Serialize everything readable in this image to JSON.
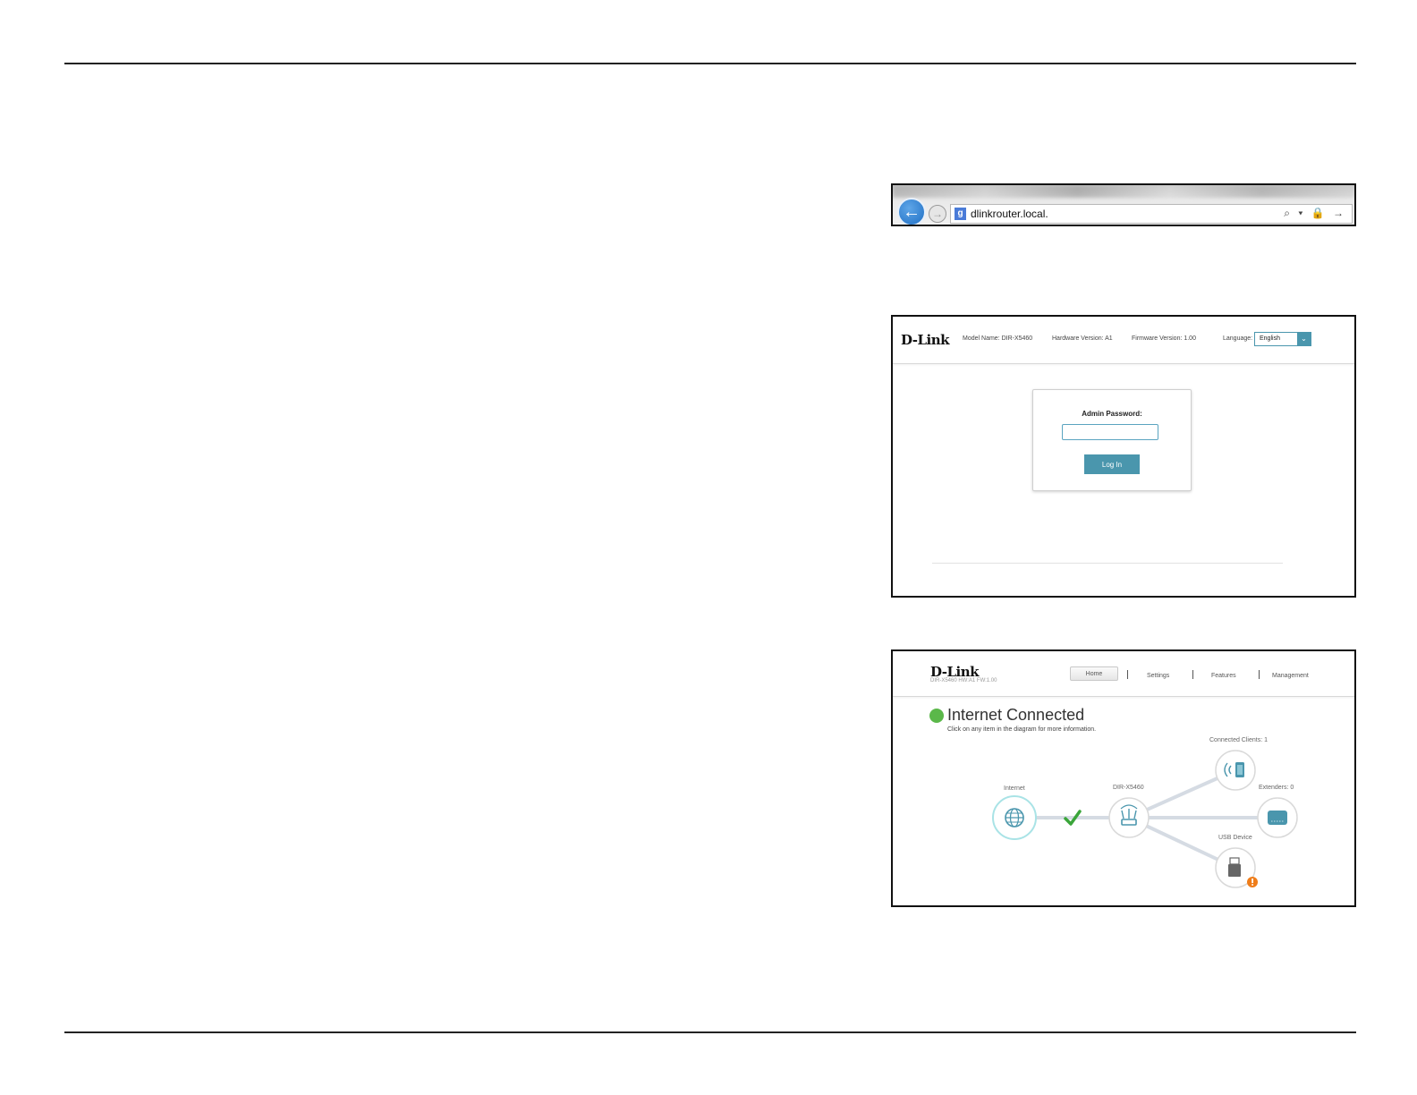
{
  "browser": {
    "url": "dlinkrouter.local.",
    "favicon_letter": "g",
    "back_icon": "arrow-left-icon",
    "forward_icon": "arrow-right-icon",
    "tools": "⌕ ▾ 🔒 →"
  },
  "login": {
    "brand": "D-Link",
    "model_name": "Model Name: DIR-X5460",
    "hardware_version": "Hardware Version: A1",
    "firmware_version": "Firmware Version: 1.00",
    "language_label": "Language:",
    "language_value": "English",
    "password_label": "Admin Password:",
    "password_value": "",
    "login_button": "Log In"
  },
  "home": {
    "brand": "D-Link",
    "subtitle": "DIR-X5460 HW:A1 FW:1.00",
    "nav": [
      "Home",
      "Settings",
      "Features",
      "Management"
    ],
    "status_title": "Internet Connected",
    "status_hint": "Click on any item in the diagram for more information.",
    "status_color": "#5bb84a",
    "accent_color": "#4a96ad",
    "nodes": {
      "internet": "Internet",
      "router": "DIR-X5460",
      "clients": "Connected Clients: 1",
      "extenders": "Extenders: 0",
      "usb": "USB Device"
    }
  }
}
